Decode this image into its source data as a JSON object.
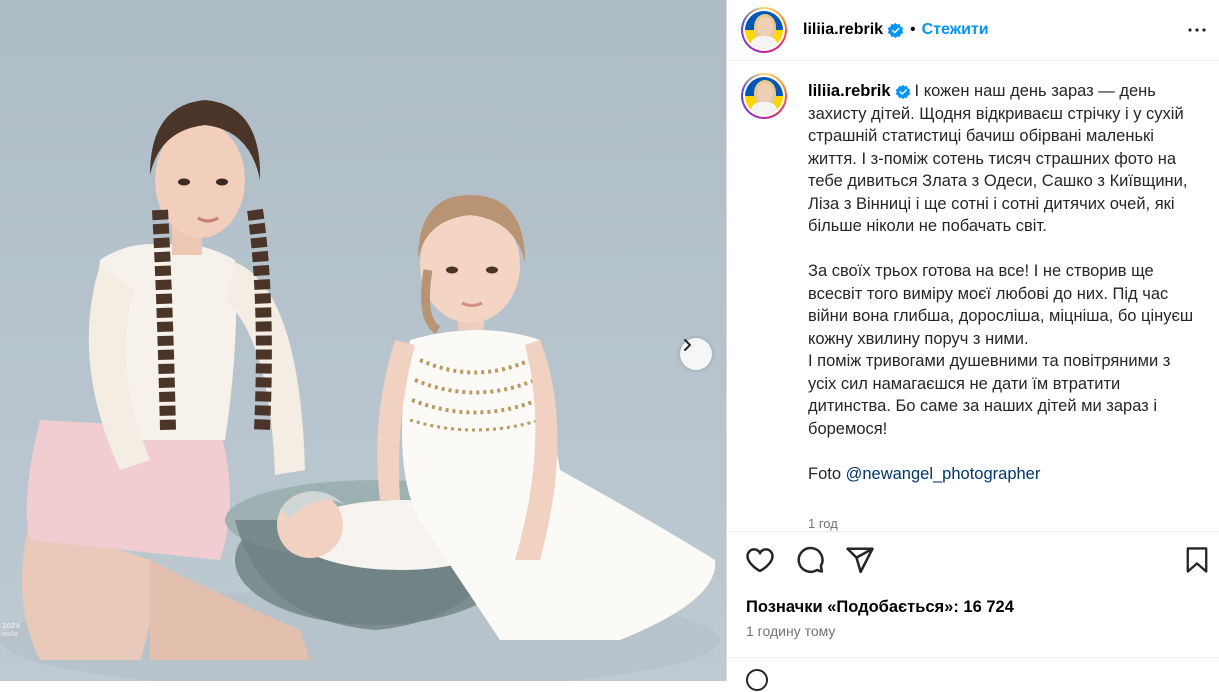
{
  "photo": {
    "watermark": "2024\nasila"
  },
  "header": {
    "username": "liliia.rebrik",
    "follow_label": "Стежити"
  },
  "caption": {
    "username": "liliia.rebrik",
    "text": "І кожен наш день зараз — день захисту дітей. Щодня відкриваєш стрічку і у сухій страшній статистиці бачиш обірвані маленькі життя. І з-поміж сотень тисяч страшних фото на тебе дивиться Злата з Одеси, Сашко з Київщини, Ліза з Вінниці і ще сотні і сотні дитячих очей, які більше ніколи не побачать світ.\n\nЗа своїх трьох готова на все! І не створив ще всесвіт того виміру моєї любові до них. Під час війни вона глибша, дорослiша, міцніша, бо цінуєш кожну хвилину поруч з ними.\nІ поміж тривогами душевними та повітряними з усіх сил намагаєшся не дати їм втратити дитинства. Бо саме за наших дітей ми зараз і боремося!\n\nFoto ",
    "mention": "@newangel_photographer",
    "age": "1 год"
  },
  "likes_text": "Позначки «Подобається»: 16 724",
  "timestamp": "1 годину тому",
  "icons": [
    "verified-badge-icon",
    "more-options-icon",
    "heart-icon",
    "comment-icon",
    "share-icon",
    "bookmark-icon",
    "chevron-right-icon"
  ],
  "colors": {
    "accent": "#0095f6",
    "verified": "#0095f6",
    "text": "#262626",
    "muted": "#737373"
  }
}
